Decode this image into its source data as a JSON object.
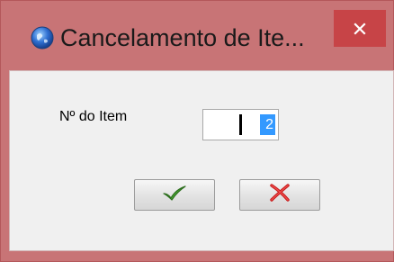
{
  "window": {
    "title": "Cancelamento de Ite...",
    "close_icon": "close-icon",
    "app_icon": "app-globe-icon"
  },
  "form": {
    "item_label": "Nº do Item",
    "item_value": "2"
  },
  "buttons": {
    "confirm_icon": "checkmark-icon",
    "cancel_icon": "x-icon"
  },
  "colors": {
    "frame": "#c87476",
    "close_button": "#c74447",
    "client_background": "#f0f0f0",
    "selection": "#3399ff",
    "check_green": "#3a9a2a",
    "x_red": "#d22020"
  }
}
